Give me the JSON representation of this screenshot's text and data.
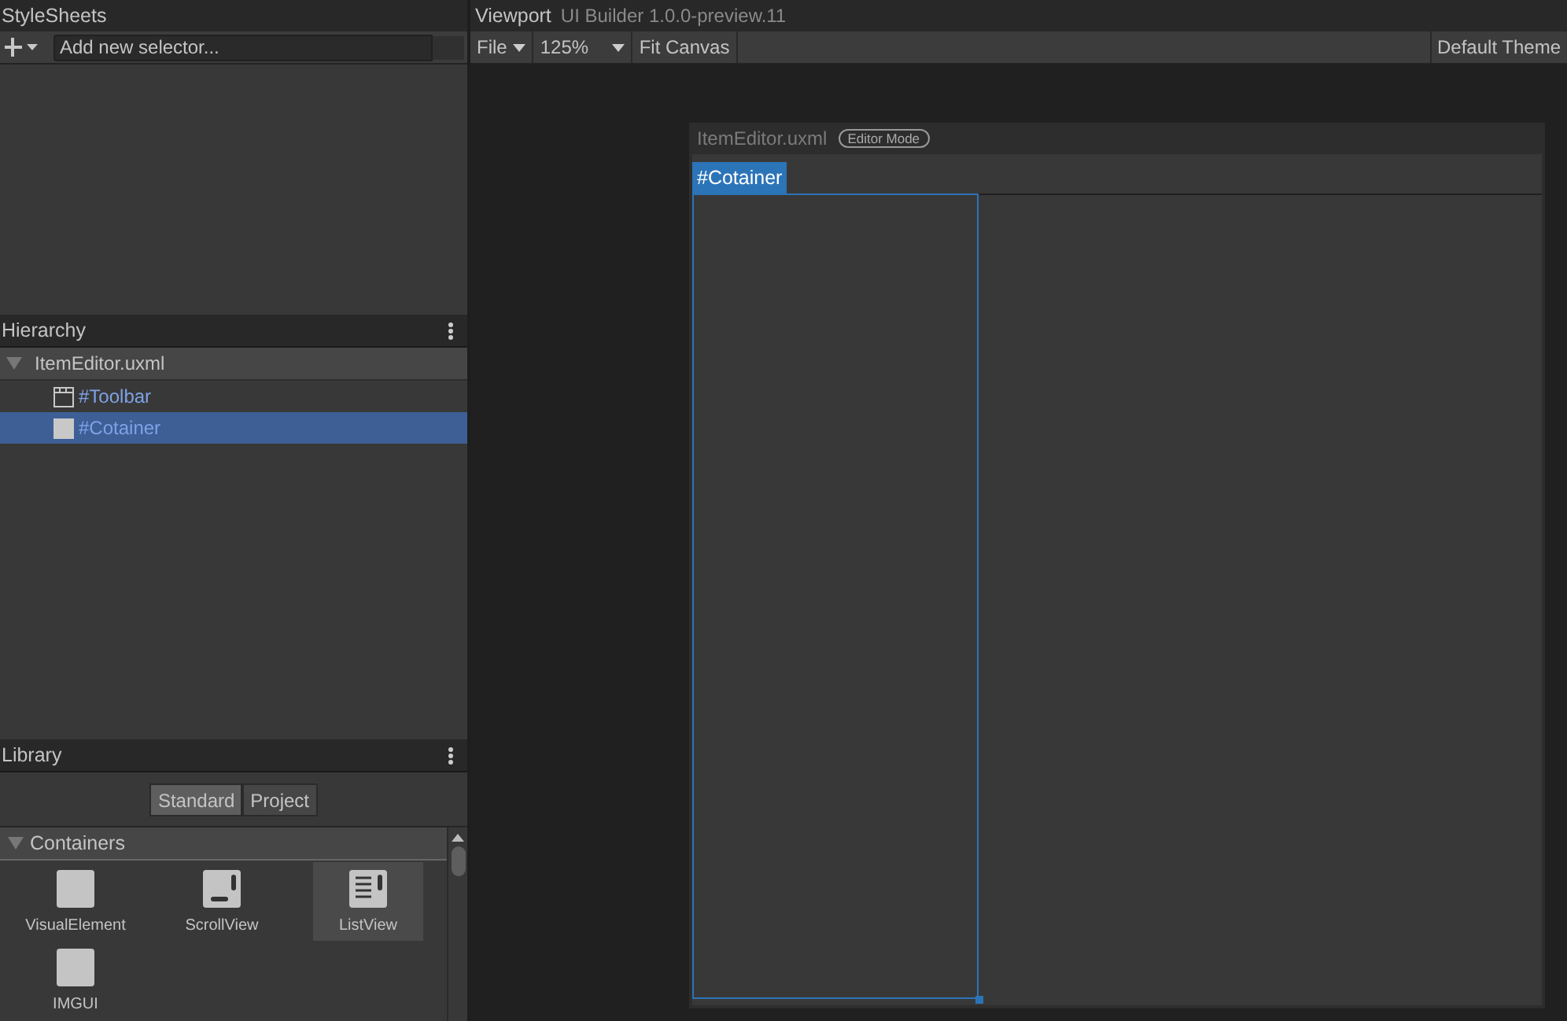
{
  "stylesheets": {
    "title": "StyleSheets",
    "selector_field": {
      "placeholder": "Add new selector..."
    }
  },
  "hierarchy": {
    "title": "Hierarchy",
    "tree": [
      {
        "label": "ItemEditor.uxml",
        "kind": "document",
        "expanded": true,
        "selected": false,
        "children": [
          {
            "label": "#Toolbar",
            "kind": "toolbar",
            "selected": false
          },
          {
            "label": "#Cotainer",
            "kind": "element",
            "selected": true
          }
        ]
      }
    ]
  },
  "library": {
    "title": "Library",
    "tabs": [
      {
        "label": "Standard",
        "selected": true
      },
      {
        "label": "Project",
        "selected": false
      }
    ],
    "categories": [
      {
        "label": "Containers",
        "expanded": true,
        "items": [
          {
            "label": "VisualElement",
            "kind": "plain",
            "selected": false
          },
          {
            "label": "ScrollView",
            "kind": "scroll",
            "selected": false
          },
          {
            "label": "ListView",
            "kind": "list",
            "selected": true
          },
          {
            "label": "IMGUI",
            "kind": "plain",
            "selected": false
          }
        ]
      }
    ]
  },
  "viewport": {
    "title": "Viewport",
    "subtitle": "UI Builder 1.0.0-preview.11",
    "toolbar": {
      "file_menu": "File",
      "zoom": "125%",
      "fit_button": "Fit Canvas",
      "theme": "Default Theme"
    },
    "canvas": {
      "title": "ItemEditor.uxml",
      "mode_badge": "Editor Mode",
      "selection_label": "#Cotainer"
    }
  }
}
